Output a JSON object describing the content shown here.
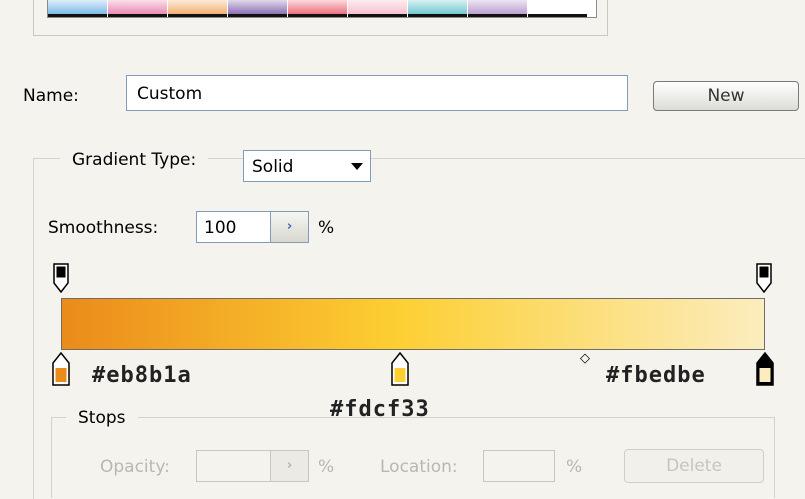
{
  "presets": {
    "swatch_colors": [
      "#6ab0e6",
      "#e778a8",
      "#f0a45a",
      "#7b5aa8",
      "#e85a6a",
      "#f5b5c5",
      "#5ac0c8",
      "#b090c8",
      "#ffffff"
    ]
  },
  "name": {
    "label": "Name:",
    "value": "Custom"
  },
  "new_button_label": "New",
  "gradient_type": {
    "label": "Gradient Type:",
    "selected": "Solid"
  },
  "smoothness": {
    "label": "Smoothness:",
    "value": "100",
    "stepper_glyph": "›",
    "unit": "%"
  },
  "gradient": {
    "start_color": "#eb8b1a",
    "mid_color": "#fdcf33",
    "end_color": "#fbedbe"
  },
  "annotations": {
    "left_hex": "#eb8b1a",
    "mid_hex": "#fdcf33",
    "right_hex": "#fbedbe"
  },
  "midpoint_glyph": "◇",
  "stops": {
    "title": "Stops",
    "opacity_label": "Opacity:",
    "opacity_stepper_glyph": "›",
    "opacity_unit": "%",
    "location_label": "Location:",
    "location_unit": "%",
    "delete_label": "Delete"
  }
}
